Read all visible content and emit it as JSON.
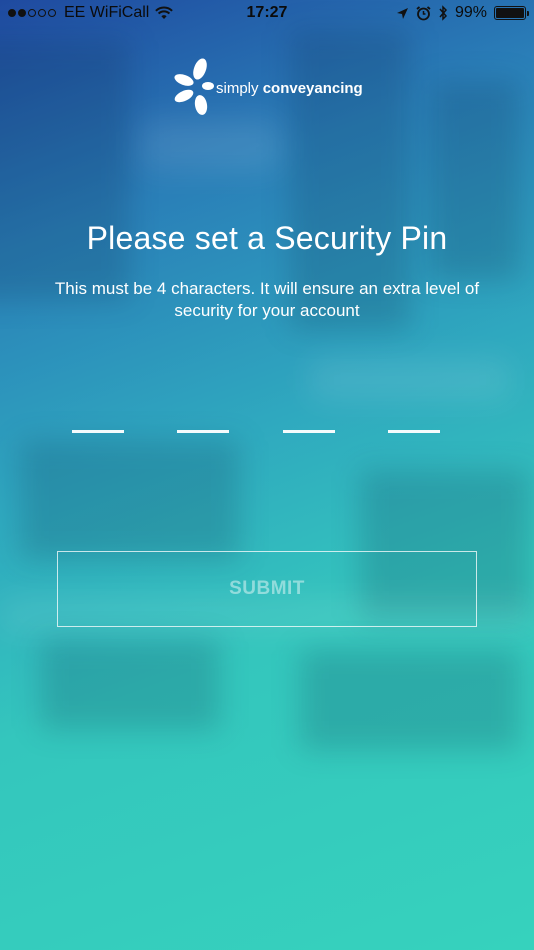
{
  "status_bar": {
    "carrier": "EE WiFiCall",
    "time": "17:27",
    "battery_percent_label": "99%",
    "battery_level": 0.99,
    "signal_dots_filled": 2,
    "signal_dots_total": 5
  },
  "logo": {
    "text_light": "simply",
    "text_bold": "conveyancing"
  },
  "title": "Please set a Security Pin",
  "subtitle": "This must be 4 characters. It will ensure an extra level of security for your account",
  "pin": {
    "length": 4,
    "values": [
      "",
      "",
      "",
      ""
    ]
  },
  "submit_label": "SUBMIT",
  "colors": {
    "gradient_top": "#1f4aa0",
    "gradient_bottom": "#36d2bd",
    "text": "#ffffff"
  },
  "icons": [
    "wifi-icon",
    "location-arrow-icon",
    "alarm-clock-icon",
    "bluetooth-icon",
    "battery-icon",
    "flower-logo-icon"
  ]
}
